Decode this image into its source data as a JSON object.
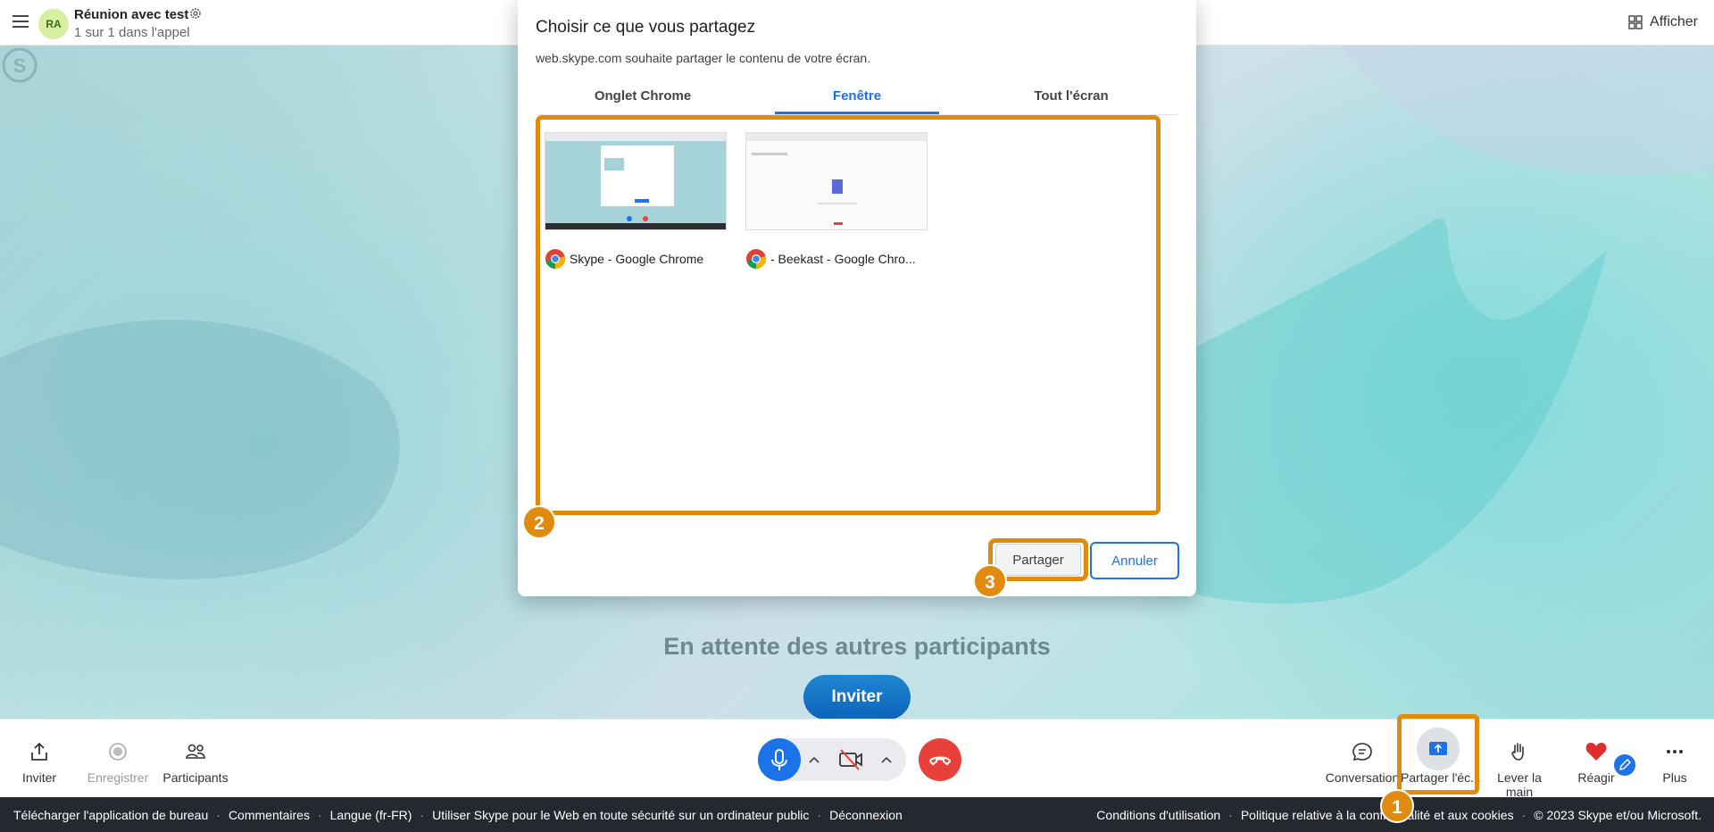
{
  "header": {
    "avatar_initials": "RA",
    "title": "Réunion avec test",
    "subtitle": "1 sur 1 dans l'appel",
    "view_button": "Afficher"
  },
  "call": {
    "waiting_text": "En attente des autres participants",
    "invite_button": "Inviter"
  },
  "dialog": {
    "title": "Choisir ce que vous partagez",
    "subtitle": "web.skype.com souhaite partager le contenu de votre écran.",
    "tabs": [
      {
        "label": "Onglet Chrome",
        "active": false
      },
      {
        "label": "Fenêtre",
        "active": true
      },
      {
        "label": "Tout l'écran",
        "active": false
      }
    ],
    "windows": [
      {
        "label": "Skype - Google Chrome",
        "icon": "chrome-icon"
      },
      {
        "label": "- Beekast - Google Chro...",
        "icon": "chrome-icon"
      }
    ],
    "share_button": "Partager",
    "cancel_button": "Annuler"
  },
  "markers": {
    "one": "1",
    "two": "2",
    "three": "3"
  },
  "toolbar": {
    "invite": "Inviter",
    "record": "Enregistrer",
    "participants": "Participants",
    "conversation": "Conversation",
    "share_screen": "Partager l'éc...",
    "raise_hand": "Lever la main",
    "react": "Réagir",
    "more": "Plus"
  },
  "footer": {
    "left_links": [
      "Télécharger l'application de bureau",
      "Commentaires",
      "Langue (fr-FR)",
      "Utiliser Skype pour le Web en toute sécurité sur un ordinateur public",
      "Déconnexion"
    ],
    "terms": "Conditions d'utilisation",
    "privacy_start": "Politique relative à la confi",
    "privacy_end": "alité et aux cookies",
    "copyright": "© 2023 Skype et/ou Microsoft."
  },
  "colors": {
    "accent": "#1a73e8",
    "highlight": "#e08a0e",
    "end_call": "#e8413c",
    "footer_bg": "#24292f"
  }
}
